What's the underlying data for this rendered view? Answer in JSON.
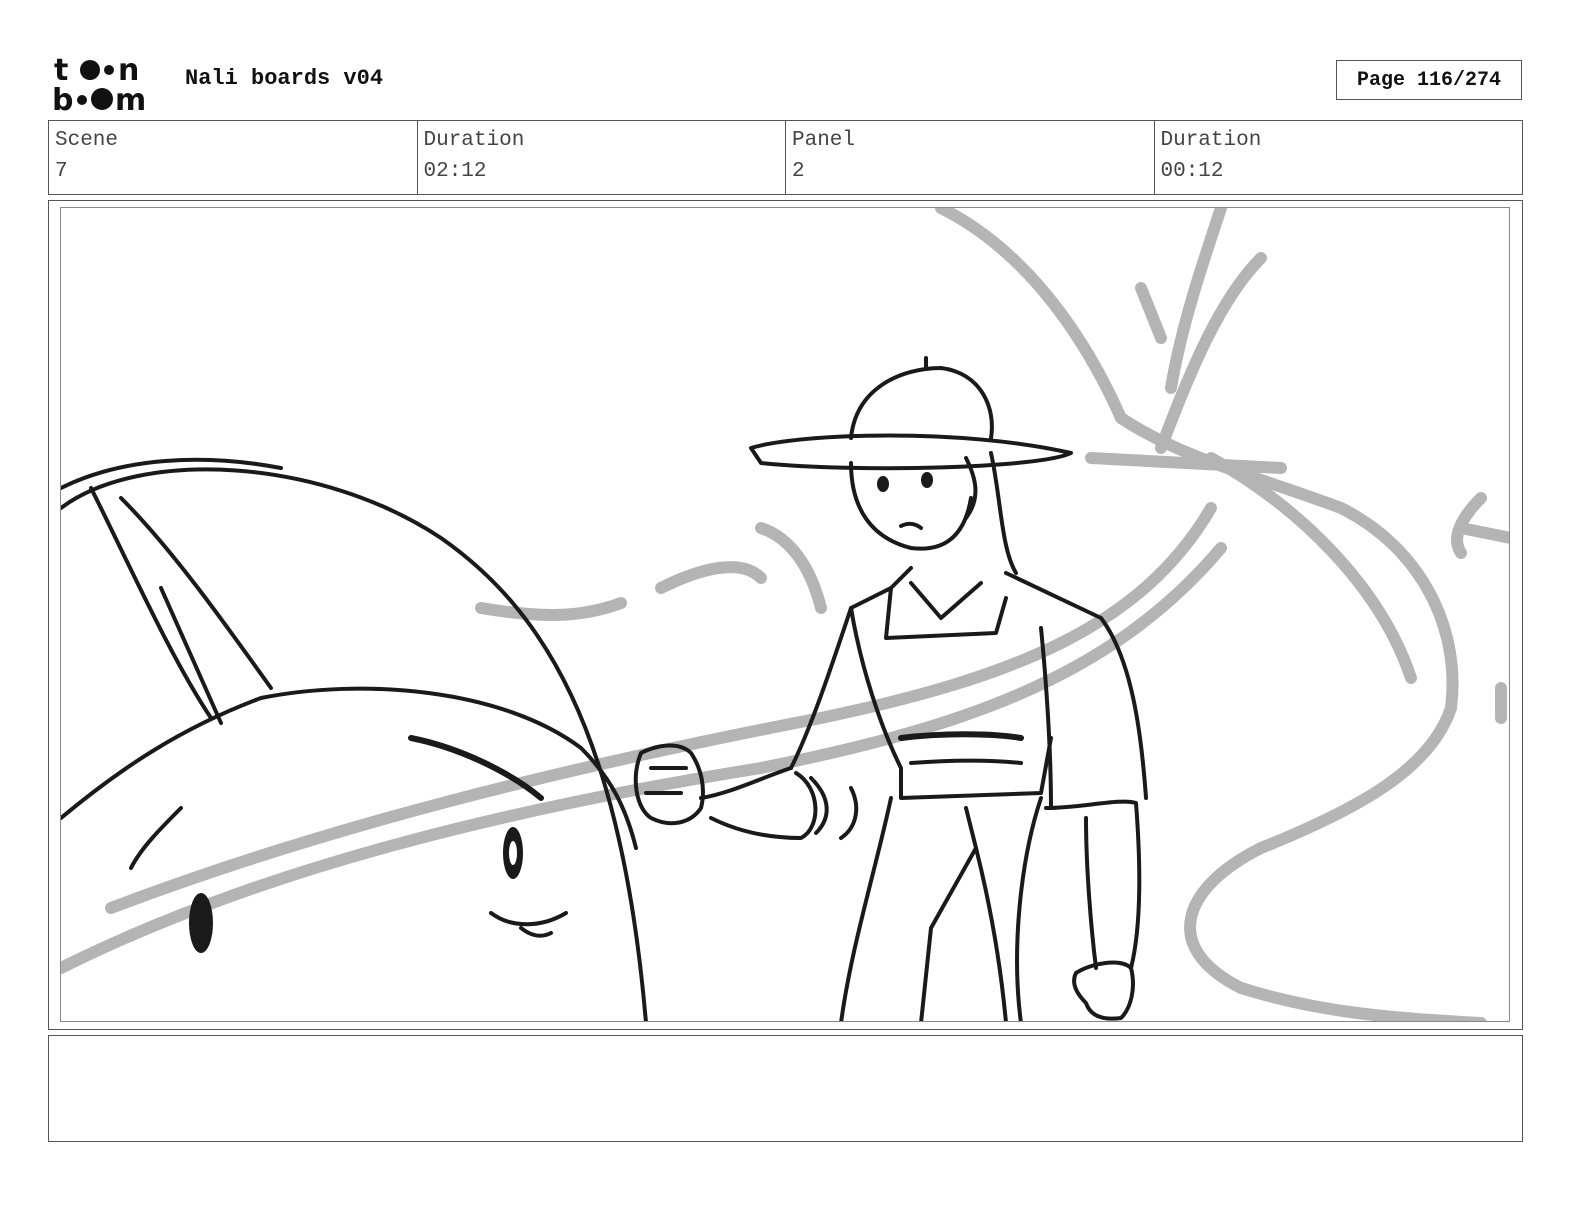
{
  "header": {
    "logo": {
      "text_line1": "toon",
      "text_line2": "boom",
      "icon": "toon-boom-logo"
    },
    "title": "Nali boards v04",
    "page": "Page 116/274"
  },
  "info": {
    "scene_label": "Scene",
    "scene_value": "7",
    "scene_duration_label": "Duration",
    "scene_duration_value": "02:12",
    "panel_label": "Panel",
    "panel_value": "2",
    "panel_duration_label": "Duration",
    "panel_duration_value": "00:12"
  },
  "panel": {
    "drawing": "storyboard-sketch"
  },
  "notes": {
    "text": ""
  }
}
